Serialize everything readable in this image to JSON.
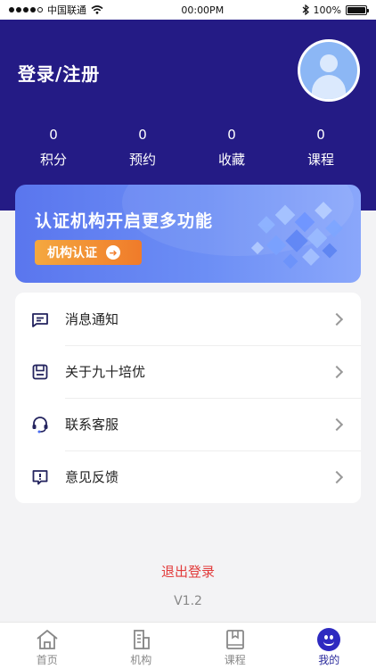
{
  "status_bar": {
    "carrier": "中国联通",
    "time": "00:00PM",
    "battery": "100%",
    "battery_level": 1.0
  },
  "header": {
    "login_label": "登录/注册",
    "stats": [
      {
        "value": "0",
        "label": "积分"
      },
      {
        "value": "0",
        "label": "预约"
      },
      {
        "value": "0",
        "label": "收藏"
      },
      {
        "value": "0",
        "label": "课程"
      }
    ]
  },
  "banner": {
    "title": "认证机构开启更多功能",
    "button_label": "机构认证"
  },
  "menu": {
    "items": [
      {
        "label": "消息通知",
        "icon": "message-icon"
      },
      {
        "label": "关于九十培优",
        "icon": "about-icon"
      },
      {
        "label": "联系客服",
        "icon": "headset-icon"
      },
      {
        "label": "意见反馈",
        "icon": "feedback-icon"
      }
    ]
  },
  "logout_label": "退出登录",
  "version": "V1.2",
  "tabbar": {
    "items": [
      {
        "label": "首页",
        "icon": "home-icon"
      },
      {
        "label": "机构",
        "icon": "building-icon"
      },
      {
        "label": "课程",
        "icon": "book-icon"
      },
      {
        "label": "我的",
        "icon": "smiley-icon"
      }
    ]
  },
  "colors": {
    "header": "#241b85",
    "accent": "#2e2ac0",
    "logout": "#e23b3b",
    "banner_button": "#f07b2a"
  }
}
